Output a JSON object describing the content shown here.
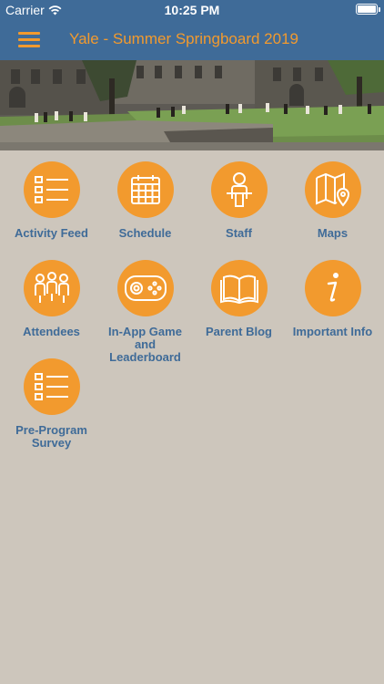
{
  "status_bar": {
    "carrier": "Carrier",
    "time": "10:25 PM",
    "battery_level": 1.0
  },
  "nav": {
    "title": "Yale - Summer Springboard 2019",
    "menu_icon": "hamburger-menu-icon"
  },
  "colors": {
    "accent": "#f29a2e",
    "nav_background": "#3f6b98",
    "page_background": "#cdc6bc",
    "label": "#3f6b98"
  },
  "tiles": [
    {
      "label": "Activity Feed",
      "icon": "list-icon"
    },
    {
      "label": "Schedule",
      "icon": "calendar-icon"
    },
    {
      "label": "Staff",
      "icon": "person-at-desk-icon"
    },
    {
      "label": "Maps",
      "icon": "map-pin-icon"
    },
    {
      "label": "Attendees",
      "icon": "group-icon"
    },
    {
      "label": "In-App Game and Leaderboard",
      "icon": "gamepad-icon"
    },
    {
      "label": "Parent Blog",
      "icon": "open-book-icon"
    },
    {
      "label": "Important Info",
      "icon": "info-icon"
    },
    {
      "label": "Pre-Program Survey",
      "icon": "list-icon"
    }
  ]
}
